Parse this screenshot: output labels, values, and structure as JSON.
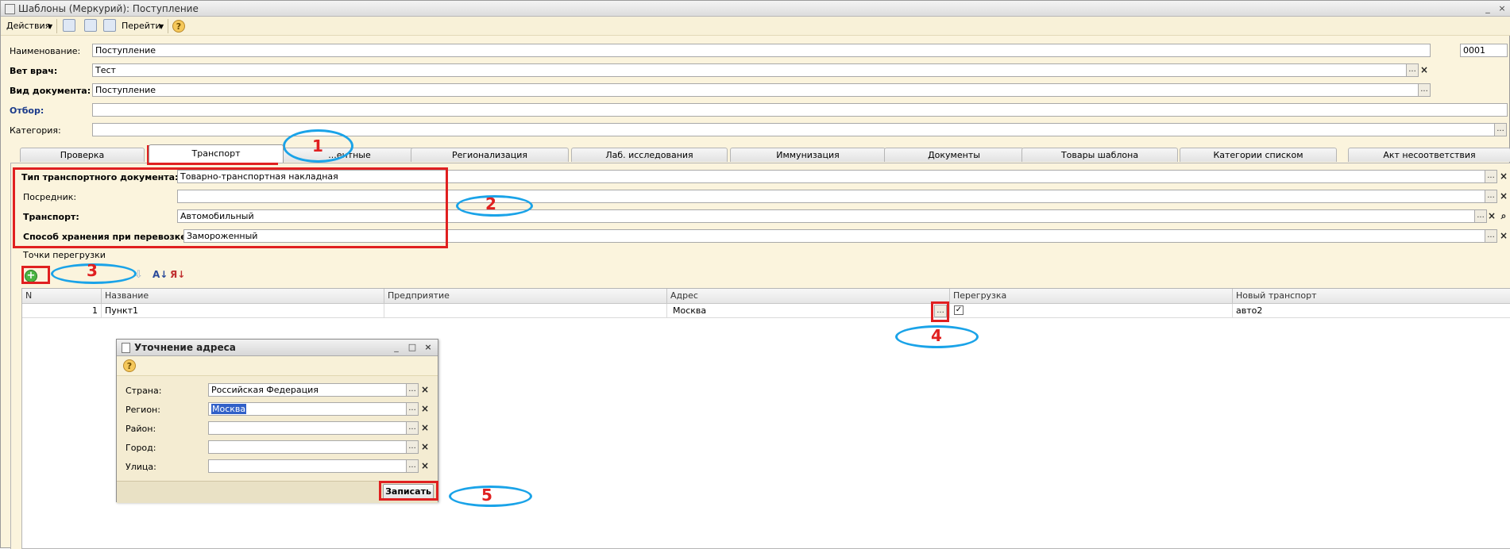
{
  "window": {
    "title": "Шаблоны (Меркурий): Поступление",
    "controls": [
      "_",
      "□",
      "×"
    ]
  },
  "toolbar": {
    "actions_label": "Действия",
    "goto_label": "Перейти",
    "help": "?"
  },
  "header": {
    "name_label": "Наименование:",
    "name_value": "Поступление",
    "code_value": "0001",
    "vet_label": "Вет врач:",
    "vet_value": "Тест",
    "doctype_label": "Вид документа:",
    "doctype_value": "Поступление",
    "filter_label": "Отбор:",
    "filter_value": "",
    "category_label": "Категория:",
    "category_value": ""
  },
  "tabs": [
    {
      "label": "Проверка"
    },
    {
      "label": "Транспорт"
    },
    {
      "label": "...ентные"
    },
    {
      "label": "Регионализация"
    },
    {
      "label": "Лаб. исследования"
    },
    {
      "label": "Иммунизация"
    },
    {
      "label": "Документы"
    },
    {
      "label": "Товары шаблона"
    },
    {
      "label": "Категории списком"
    },
    {
      "label": "Акт несоответствия"
    }
  ],
  "transport": {
    "doc_type_label": "Тип транспортного документа:",
    "doc_type_value": "Товарно-транспортная накладная",
    "intermediary_label": "Посредник:",
    "intermediary_value": "",
    "transport_label": "Транспорт:",
    "transport_value": "Автомобильный",
    "storage_label": "Способ хранения при перевозке:",
    "storage_value": "Замороженный"
  },
  "points": {
    "group_label": "Точки перегрузки",
    "columns": [
      "N",
      "Название",
      "Предприятие",
      "Адрес",
      "Перегрузка",
      "Новый транспорт"
    ],
    "rows": [
      {
        "n": "1",
        "name": "Пункт1",
        "enterprise": "",
        "address": "Москва",
        "reload": true,
        "new_transport": "авто2"
      }
    ]
  },
  "dialog": {
    "title": "Уточнение адреса",
    "country_label": "Страна:",
    "country_value": "Российская Федерация",
    "region_label": "Регион:",
    "region_value": "Москва",
    "district_label": "Район:",
    "district_value": "",
    "city_label": "Город:",
    "city_value": "",
    "street_label": "Улица:",
    "street_value": "",
    "save_label": "Записать"
  },
  "annotations": {
    "n1": "1",
    "n2": "2",
    "n3": "3",
    "n4": "4",
    "n5": "5"
  },
  "colors": {
    "annotation_red": "#e02020",
    "annotation_blue": "#1aa3e8",
    "form_bg": "#fbf4dd"
  },
  "icons": [
    "window-icon",
    "help-icon",
    "add-row-icon",
    "sort-asc-icon",
    "sort-desc-icon",
    "arrow-down-icon",
    "checkbox-checked-icon"
  ]
}
